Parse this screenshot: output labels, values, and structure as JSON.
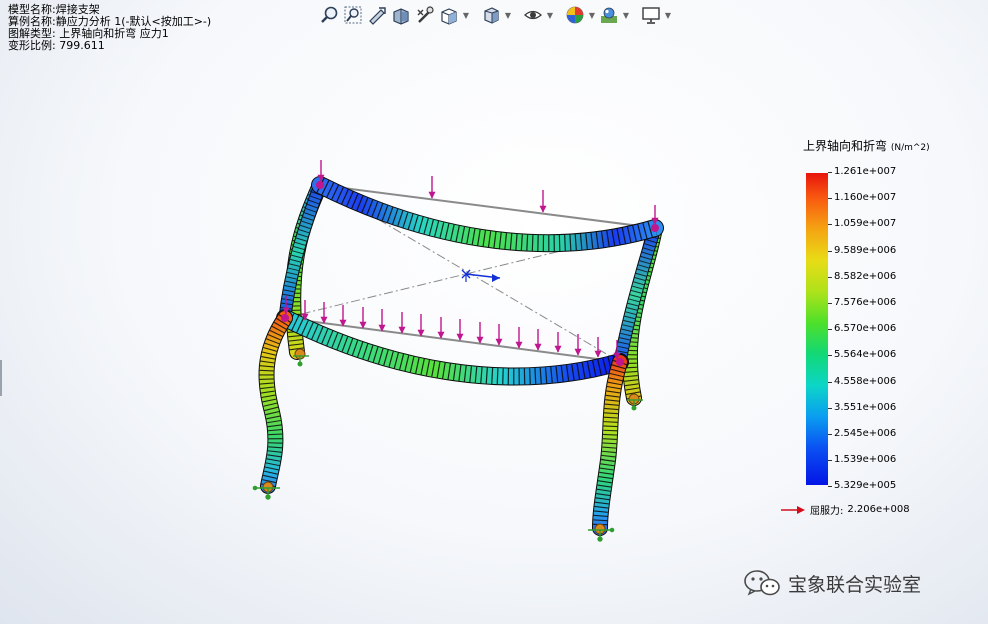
{
  "study_info": {
    "model_name_label": "模型名称:",
    "model_name": "焊接支架",
    "study_name_label": "算例名称:",
    "study_name": "静应力分析 1(-默认<按加工>-)",
    "plot_type_label": "图解类型:",
    "plot_type": "上界轴向和折弯 应力1",
    "deformation_label": "变形比例:",
    "deformation_scale": "799.611"
  },
  "toolbar": {
    "buttons": [
      {
        "icon": "zoom-to-fit-icon"
      },
      {
        "icon": "zoom-to-area-icon"
      },
      {
        "icon": "previous-view-icon"
      },
      {
        "icon": "section-view-icon"
      },
      {
        "icon": "dynamic-annotation-icon"
      },
      {
        "icon": "view-orientation-icon",
        "dropdown": true
      },
      {
        "icon": "display-style-icon",
        "dropdown": true
      },
      {
        "icon": "hide-show-items-icon",
        "dropdown": true
      },
      {
        "icon": "edit-appearance-icon",
        "dropdown": true
      },
      {
        "icon": "apply-scene-icon",
        "dropdown": true
      },
      {
        "icon": "view-settings-icon",
        "dropdown": true
      }
    ]
  },
  "legend": {
    "title": "上界轴向和折弯",
    "unit": "(N/m^2)",
    "labels": [
      "1.261e+007",
      "1.160e+007",
      "1.059e+007",
      "9.589e+006",
      "8.582e+006",
      "7.576e+006",
      "6.570e+006",
      "5.564e+006",
      "4.558e+006",
      "3.551e+006",
      "2.545e+006",
      "1.539e+006",
      "5.329e+005"
    ],
    "yield_label": "屈服力:",
    "yield_value": "2.206e+008",
    "yield_arrow_color": "#d10f1b"
  },
  "watermark": {
    "text": "宝象联合实验室"
  },
  "colors": {
    "load_arrow": "#c0168e",
    "fixture": "#2e9e2e",
    "max_stress": "#e8150c",
    "min_stress": "#0414e6"
  }
}
